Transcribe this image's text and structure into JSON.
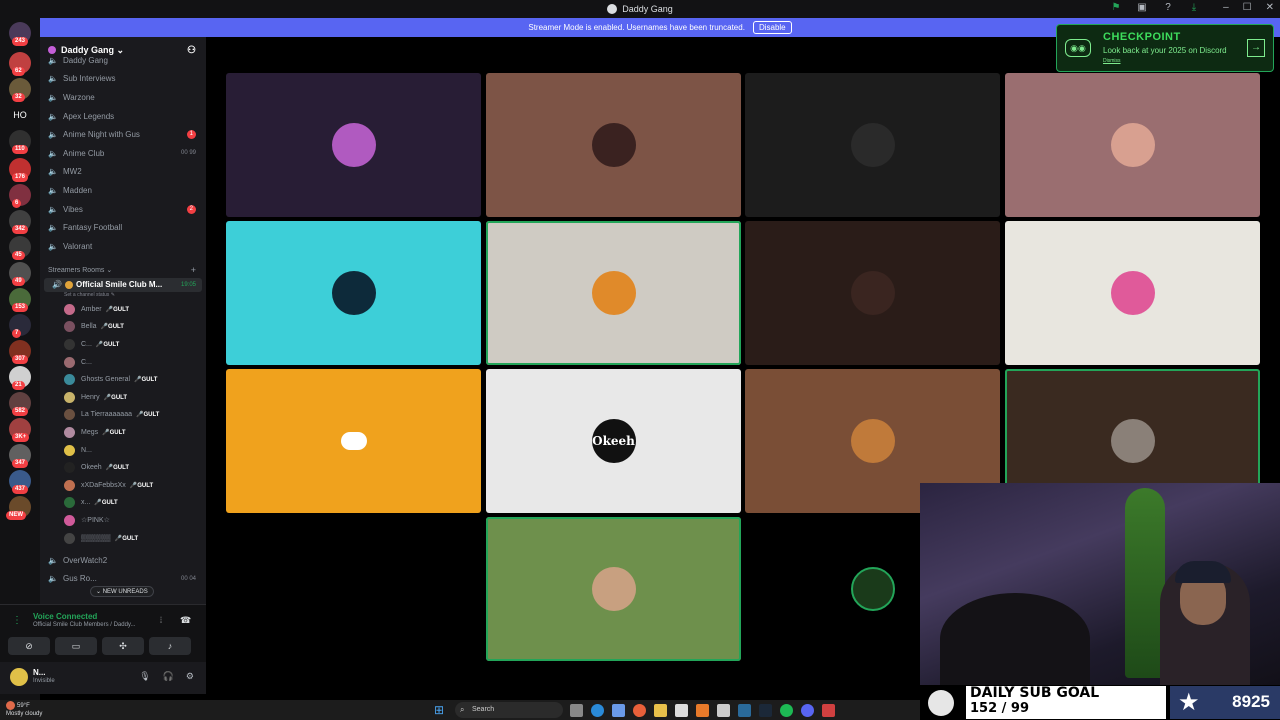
{
  "titlebar": {
    "title": "Daddy Gang"
  },
  "banner": {
    "text": "Streamer Mode is enabled. Usernames have been truncated.",
    "button": "Disable"
  },
  "guild_badges": [
    "243",
    "62",
    "32",
    "HO",
    "110",
    "176",
    "6",
    "342",
    "45",
    "49",
    "153",
    "7",
    "307",
    "21",
    "582",
    "3K+",
    "347",
    "437",
    "NEW"
  ],
  "server": {
    "name": "Daddy Gang ⌄"
  },
  "channels": [
    {
      "name": "Daddy Gang"
    },
    {
      "name": "Sub Interviews"
    },
    {
      "name": "Warzone"
    },
    {
      "name": "Apex Legends"
    },
    {
      "name": "Anime Night with Gus",
      "badge": "1"
    },
    {
      "name": "Anime Club",
      "meta": "00 99"
    },
    {
      "name": "MW2"
    },
    {
      "name": "Madden"
    },
    {
      "name": "Vibes",
      "badge": "2"
    },
    {
      "name": "Fantasy Football"
    },
    {
      "name": "Valorant"
    }
  ],
  "category": {
    "name": "Streamers Rooms ⌄",
    "plus": "+"
  },
  "voice_channel": {
    "name": "Official Smile Club M...",
    "timer": "19:05",
    "status": "Set a channel status ✎"
  },
  "members": [
    {
      "name": "Amber",
      "tag": "🎤GULT",
      "color": "#c46a8a"
    },
    {
      "name": "Bella",
      "tag": "🎤GULT",
      "color": "#7a5060"
    },
    {
      "name": "C...",
      "tag": "🎤GULT",
      "color": "#333"
    },
    {
      "name": "C...",
      "tag": "",
      "color": "#9a6a70"
    },
    {
      "name": "Ghosts General",
      "tag": "🎤GULT",
      "color": "#3a8a9a"
    },
    {
      "name": "Henry",
      "tag": "🎤GULT",
      "color": "#c8b36a"
    },
    {
      "name": "La Tierraaaaaaa",
      "tag": "🎤GULT",
      "color": "#6a5040"
    },
    {
      "name": "Megs",
      "tag": "🎤GULT",
      "color": "#b08aa0"
    },
    {
      "name": "N...",
      "tag": "",
      "color": "#e0c048"
    },
    {
      "name": "Okeeh",
      "tag": "🎤GULT",
      "color": "#222"
    },
    {
      "name": "xXDaFebbsXx",
      "tag": "🎤GULT",
      "color": "#c07050"
    },
    {
      "name": "x...",
      "tag": "🎤GULT",
      "color": "#2a6a3a"
    },
    {
      "name": "☆PINK☆",
      "tag": "",
      "color": "#d05a9a"
    },
    {
      "name": "▒▒▒▒▒▒",
      "tag": "🎤GULT",
      "color": "#444"
    }
  ],
  "more_channels": [
    {
      "name": "OverWatch2"
    },
    {
      "name": "Gus Ro...",
      "meta": "00 04"
    }
  ],
  "new_unreads": "⌄ NEW UNREADS",
  "voice_panel": {
    "title": "Voice Connected",
    "subtitle": "Official Smile Club Members / Daddy..."
  },
  "user": {
    "name": "N...",
    "status": "Invisible"
  },
  "tiles": [
    {
      "bg": "#281d35",
      "avatar": "#b05ac0",
      "speaking": false
    },
    {
      "bg": "#7d5446",
      "avatar": "#3a2220",
      "speaking": false
    },
    {
      "bg": "#1c1c1c",
      "avatar": "#2a2a2a",
      "speaking": false
    },
    {
      "bg": "#9a6e70",
      "avatar": "#d8a090",
      "speaking": false
    },
    {
      "bg": "#3dcfd8",
      "avatar": "#0d2a3a",
      "speaking": false
    },
    {
      "bg": "#cfcbc3",
      "avatar": "#e08a2a",
      "speaking": true
    },
    {
      "bg": "#2a1c18",
      "avatar": "#3a2520",
      "speaking": false
    },
    {
      "bg": "#e8e6df",
      "avatar": "#e05a9a",
      "speaking": false
    },
    {
      "bg": "#f0a21d",
      "avatar": "#ffffff",
      "speaking": false
    },
    {
      "bg": "#e8e8e8",
      "avatar": "#111111",
      "speaking": false
    },
    {
      "bg": "#7a4e36",
      "avatar": "#c07a3a",
      "speaking": false
    },
    {
      "bg": "#3a2a20",
      "avatar": "#8a8078",
      "speaking": true
    },
    {
      "bg": "#6e904c",
      "avatar": "#c8a080",
      "speaking": true
    },
    {
      "bg": "#000000",
      "avatar": "#1a3a1a",
      "speaking": false
    }
  ],
  "okeeh_label": "Okeeh",
  "checkpoint": {
    "title": "CHECKPOINT",
    "subtitle": "Look back at your 2025 on Discord",
    "link": "Dismiss"
  },
  "subgoal": {
    "title": "DAILY SUB GOAL",
    "count": "152 / 99",
    "value": "8925"
  },
  "taskbar": {
    "temp": "59°F",
    "weather": "Mostly cloudy",
    "search": "Search"
  },
  "colors": {
    "accent": "#5865f2",
    "green": "#23a559",
    "red": "#f23f43"
  }
}
